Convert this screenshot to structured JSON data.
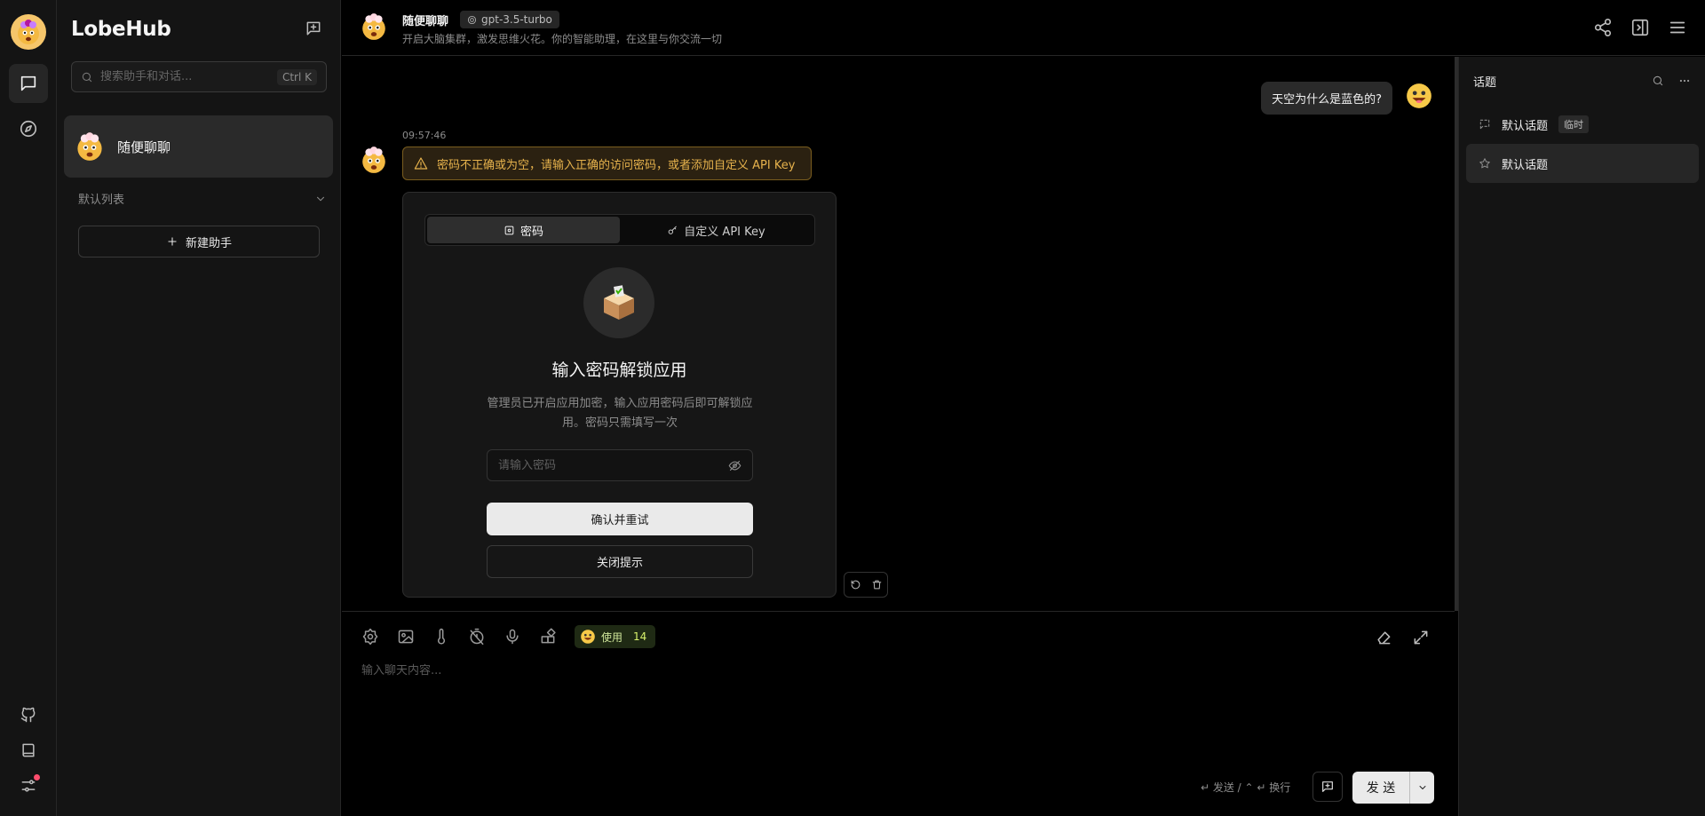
{
  "app": {
    "logo": "LobeHub"
  },
  "search": {
    "placeholder": "搜索助手和对话...",
    "shortcut": "Ctrl K"
  },
  "sessions": [
    {
      "name": "随便聊聊",
      "avatar": "🤯"
    }
  ],
  "group": {
    "label": "默认列表"
  },
  "sidebar": {
    "new_agent_label": "新建助手"
  },
  "header": {
    "title": "随便聊聊",
    "model": "gpt-3.5-turbo",
    "description": "开启大脑集群，激发思维火花。你的智能助理，在这里与你交流一切"
  },
  "chat": {
    "user_message": "天空为什么是蓝色的?",
    "timestamp": "09:57:46",
    "alert_text": "密码不正确或为空，请输入正确的访问密码，或者添加自定义 API Key",
    "auth": {
      "tab_password": "密码",
      "tab_api_key": "自定义 API Key",
      "title": "输入密码解锁应用",
      "description": "管理员已开启应用加密，输入应用密码后即可解锁应用。密码只需填写一次",
      "password_placeholder": "请输入密码",
      "confirm_label": "确认并重试",
      "close_label": "关闭提示"
    }
  },
  "input": {
    "placeholder": "输入聊天内容...",
    "token_label": "使用",
    "token_count": "14",
    "hint": "↵ 发送 / ⌃ ↵ 换行",
    "send_label": "发 送"
  },
  "topics": {
    "title": "话题",
    "items": [
      {
        "name": "默认话题",
        "badge": "临时"
      },
      {
        "name": "默认话题"
      }
    ]
  },
  "colors": {
    "accent_warning": "#e6b24c",
    "token_accent": "#d7f06b",
    "notify_dot": "#ff4d6d"
  }
}
